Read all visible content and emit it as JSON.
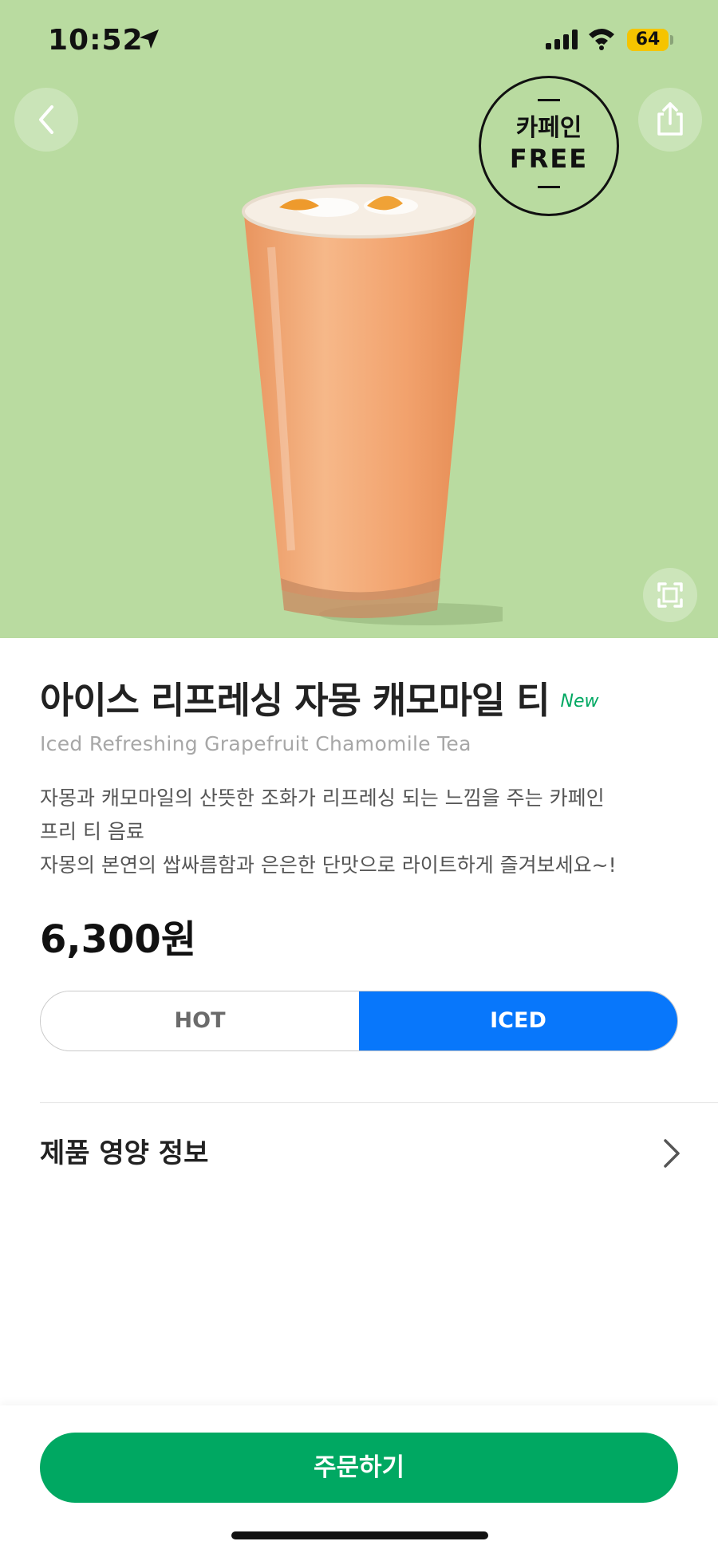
{
  "status_bar": {
    "time": "10:52",
    "battery": "64"
  },
  "badge": {
    "line1": "카페인",
    "line2": "FREE"
  },
  "product": {
    "name_ko": "아이스 리프레싱 자몽 캐모마일 티",
    "new_label": "New",
    "name_en": "Iced Refreshing Grapefruit Chamomile Tea",
    "description_line1": "자몽과 캐모마일의 산뜻한 조화가 리프레싱 되는 느낌을 주는 카페인",
    "description_line2": "프리 티 음료",
    "description_line3": "자몽의 본연의 쌉싸름함과 은은한 단맛으로 라이트하게 즐겨보세요~!",
    "price": "6,300원"
  },
  "temperature": {
    "hot_label": "HOT",
    "iced_label": "ICED",
    "selected": "ICED"
  },
  "nutrition": {
    "label": "제품 영양 정보"
  },
  "order": {
    "button_label": "주문하기"
  },
  "colors": {
    "hero_bg": "#b9dba0",
    "accent_green": "#00a862",
    "selected_blue": "#0877fb"
  },
  "icons": [
    "location-arrow-icon",
    "signal-icon",
    "wifi-icon",
    "back-icon",
    "share-icon",
    "expand-icon",
    "chevron-right-icon"
  ]
}
